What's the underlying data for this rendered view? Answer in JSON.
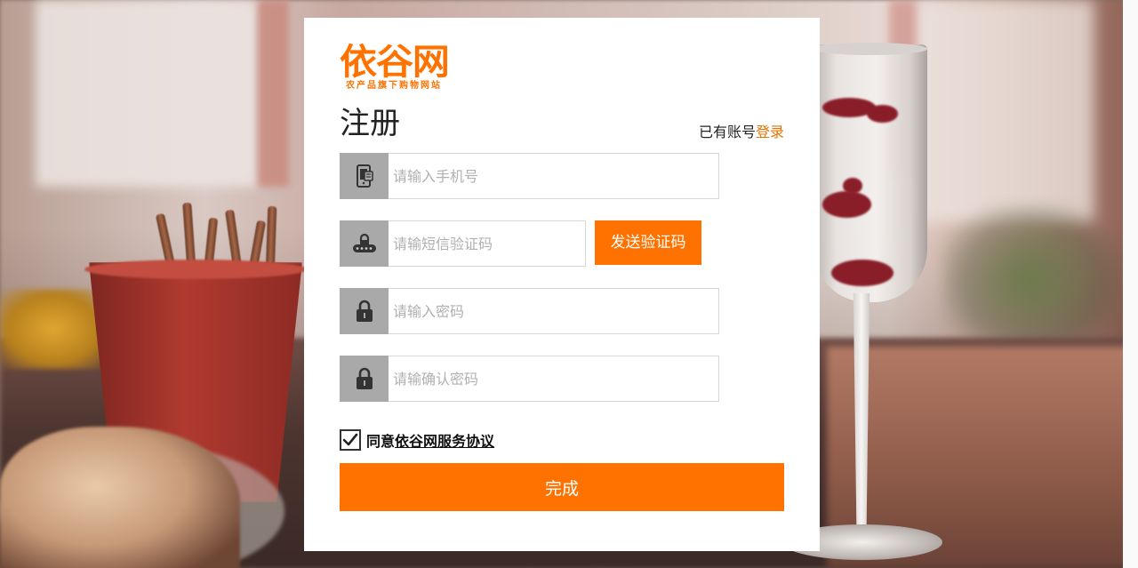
{
  "brand": {
    "logo_text": "依谷网",
    "tagline": "农产品旗下购物网站",
    "color": "#ff7200"
  },
  "form": {
    "title": "注册",
    "have_account_prefix": "已有账号",
    "login_link": "登录",
    "phone": {
      "placeholder": "请输入手机号",
      "value": "",
      "icon": "mobile-phone-icon"
    },
    "sms_code": {
      "placeholder": "请输短信验证码",
      "value": "",
      "icon": "keypad-lock-icon"
    },
    "send_code_button": "发送验证码",
    "password": {
      "placeholder": "请输入密码",
      "value": "",
      "icon": "padlock-icon"
    },
    "confirm_password": {
      "placeholder": "请输确认密码",
      "value": "",
      "icon": "padlock-icon"
    },
    "agree_checked": true,
    "agree_prefix": "同意",
    "agree_link": "依谷网服务协议",
    "submit_button": "完成"
  },
  "colors": {
    "accent": "#ff7200",
    "login_link": "#e07400",
    "icon_bg": "#a9a9a9",
    "panel_bg": "#ffffff"
  }
}
